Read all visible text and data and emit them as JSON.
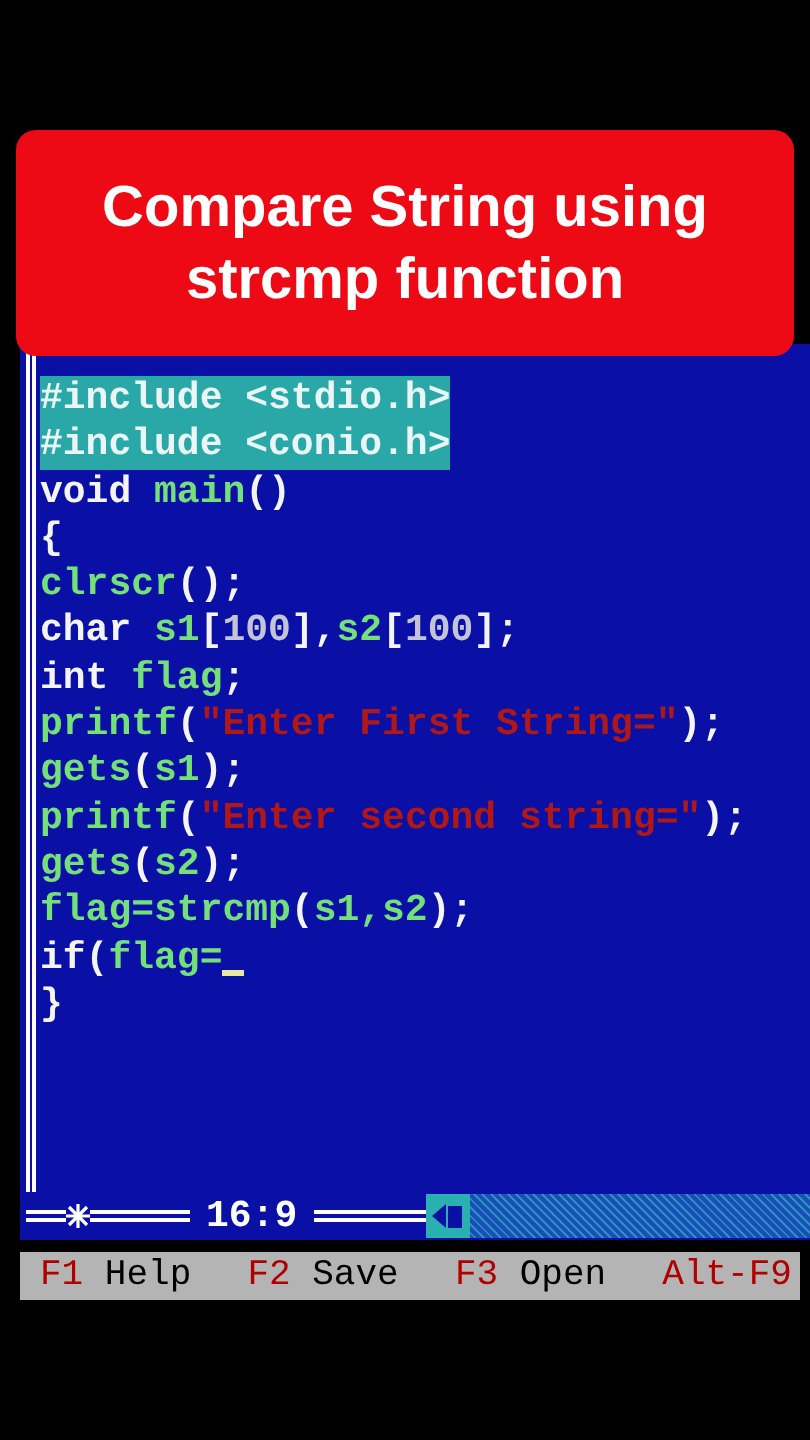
{
  "banner": {
    "title": "Compare String using strcmp function"
  },
  "editor": {
    "lines": [
      {
        "selected": true,
        "cursor": false,
        "tokens": [
          {
            "kind": "plain",
            "text": "#include <stdio.h>"
          }
        ]
      },
      {
        "selected": true,
        "cursor": false,
        "tokens": [
          {
            "kind": "plain",
            "text": "#include <conio.h>"
          }
        ]
      },
      {
        "selected": false,
        "cursor": false,
        "tokens": [
          {
            "kind": "keyword",
            "text": "void "
          },
          {
            "kind": "ident",
            "text": "main"
          },
          {
            "kind": "keyword",
            "text": "()"
          }
        ]
      },
      {
        "selected": false,
        "cursor": false,
        "tokens": [
          {
            "kind": "keyword",
            "text": "{"
          }
        ]
      },
      {
        "selected": false,
        "cursor": false,
        "tokens": [
          {
            "kind": "ident",
            "text": "clrscr"
          },
          {
            "kind": "keyword",
            "text": "();"
          }
        ]
      },
      {
        "selected": false,
        "cursor": false,
        "tokens": [
          {
            "kind": "keyword",
            "text": "char "
          },
          {
            "kind": "ident",
            "text": "s1"
          },
          {
            "kind": "keyword",
            "text": "["
          },
          {
            "kind": "number",
            "text": "100"
          },
          {
            "kind": "keyword",
            "text": "],"
          },
          {
            "kind": "ident",
            "text": "s2"
          },
          {
            "kind": "keyword",
            "text": "["
          },
          {
            "kind": "number",
            "text": "100"
          },
          {
            "kind": "keyword",
            "text": "];"
          }
        ]
      },
      {
        "selected": false,
        "cursor": false,
        "tokens": [
          {
            "kind": "keyword",
            "text": "int "
          },
          {
            "kind": "ident",
            "text": "flag"
          },
          {
            "kind": "keyword",
            "text": ";"
          }
        ]
      },
      {
        "selected": false,
        "cursor": false,
        "tokens": [
          {
            "kind": "ident",
            "text": "printf"
          },
          {
            "kind": "keyword",
            "text": "("
          },
          {
            "kind": "string",
            "text": "\"Enter First String=\""
          },
          {
            "kind": "keyword",
            "text": ");"
          }
        ]
      },
      {
        "selected": false,
        "cursor": false,
        "tokens": [
          {
            "kind": "ident",
            "text": "gets"
          },
          {
            "kind": "keyword",
            "text": "("
          },
          {
            "kind": "ident",
            "text": "s1"
          },
          {
            "kind": "keyword",
            "text": ");"
          }
        ]
      },
      {
        "selected": false,
        "cursor": false,
        "tokens": [
          {
            "kind": "ident",
            "text": "printf"
          },
          {
            "kind": "keyword",
            "text": "("
          },
          {
            "kind": "string",
            "text": "\"Enter second string=\""
          },
          {
            "kind": "keyword",
            "text": ");"
          }
        ]
      },
      {
        "selected": false,
        "cursor": false,
        "tokens": [
          {
            "kind": "ident",
            "text": "gets"
          },
          {
            "kind": "keyword",
            "text": "("
          },
          {
            "kind": "ident",
            "text": "s2"
          },
          {
            "kind": "keyword",
            "text": ");"
          }
        ]
      },
      {
        "selected": false,
        "cursor": false,
        "tokens": [
          {
            "kind": "ident",
            "text": "flag=strcmp"
          },
          {
            "kind": "keyword",
            "text": "("
          },
          {
            "kind": "ident",
            "text": "s1,s2"
          },
          {
            "kind": "keyword",
            "text": ");"
          }
        ]
      },
      {
        "selected": false,
        "cursor": true,
        "tokens": [
          {
            "kind": "keyword",
            "text": "if("
          },
          {
            "kind": "ident",
            "text": "flag="
          }
        ]
      },
      {
        "selected": false,
        "cursor": false,
        "tokens": [
          {
            "kind": "keyword",
            "text": "}"
          }
        ]
      }
    ],
    "position": "16:9"
  },
  "function_keys": [
    {
      "key": "F1",
      "label": "Help"
    },
    {
      "key": "F2",
      "label": "Save"
    },
    {
      "key": "F3",
      "label": "Open"
    },
    {
      "key": "Alt-F9"
    }
  ]
}
